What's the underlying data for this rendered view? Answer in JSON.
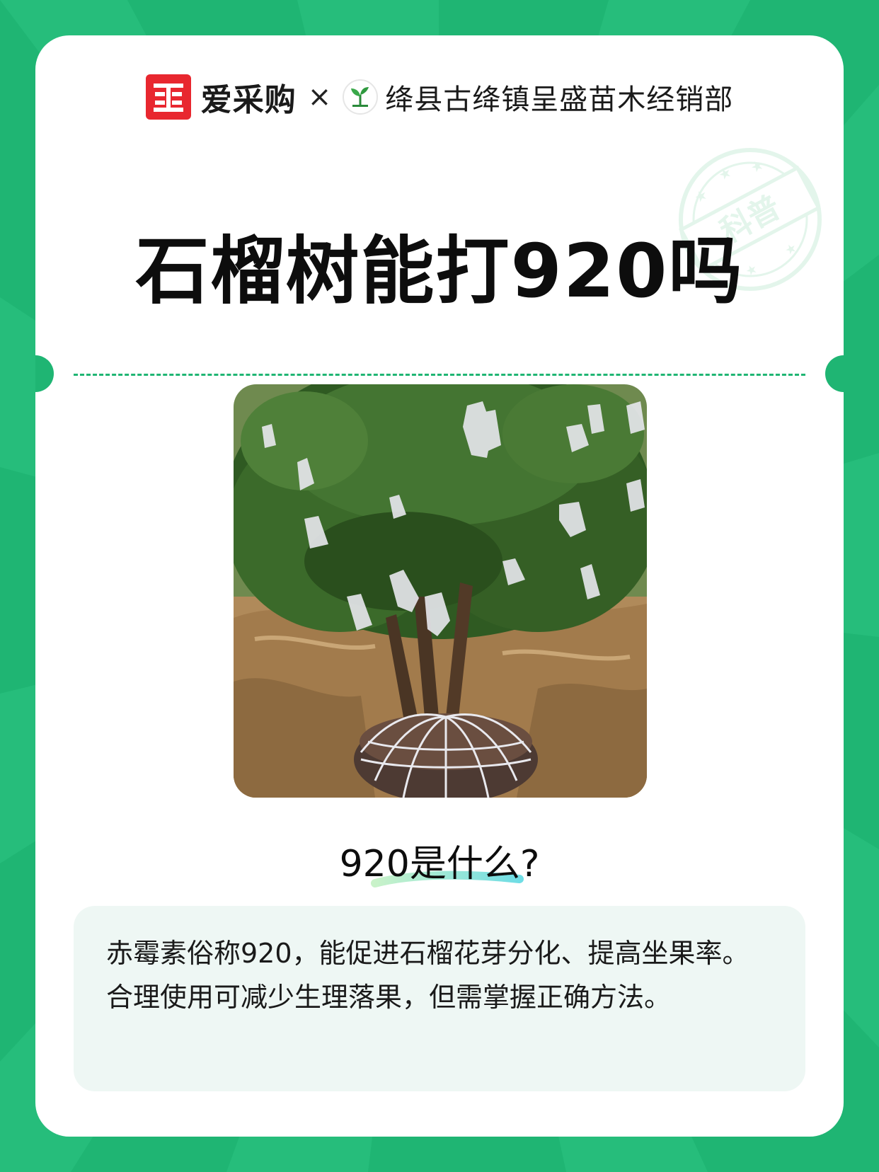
{
  "header": {
    "brand_logo_char": "采",
    "brand_name": "爱采购",
    "separator": "×",
    "partner_name": "绛县古绛镇呈盛苗木经销部"
  },
  "stamp": {
    "text": "科普"
  },
  "title": "石榴树能打920吗",
  "subtitle": "920是什么?",
  "description": "赤霉素俗称920，能促进石榴花芽分化、提高坐果率。合理使用可减少生理落果，但需掌握正确方法。",
  "colors": {
    "background": "#1fb573",
    "accent": "#1fb573",
    "brand_red": "#e8272f",
    "info_box": "#eef7f4"
  }
}
